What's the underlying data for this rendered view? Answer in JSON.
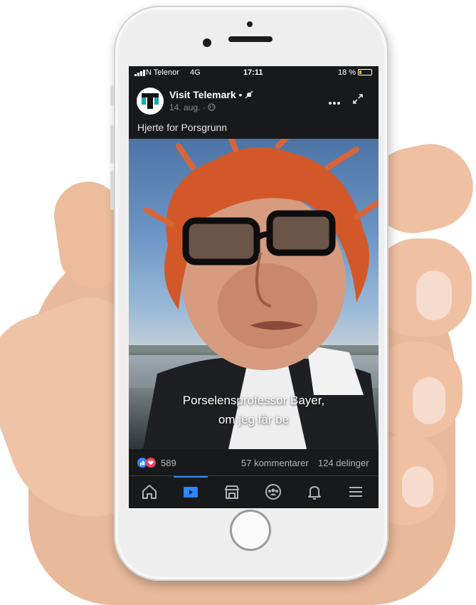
{
  "status_bar": {
    "carrier": "N Telenor",
    "network": "4G",
    "time": "17:11",
    "battery": "18 %",
    "battery_level": 0.18
  },
  "post": {
    "page_name": "Visit Telemark",
    "separator": "•",
    "date": "14. aug.",
    "caption": "Hjerte for Porsgrunn",
    "avatar_text": "T"
  },
  "video": {
    "subtitle_line1": "Porselensprofessor Bayer,",
    "subtitle_line2": "om jeg får be"
  },
  "reactions": {
    "count": "589",
    "comments": "57 kommentarer",
    "shares": "124 delinger",
    "like_color": "#2d88ff",
    "love_color": "#f33e58"
  },
  "tabs": [
    {
      "name": "home-icon"
    },
    {
      "name": "watch-icon",
      "active": true
    },
    {
      "name": "marketplace-icon"
    },
    {
      "name": "groups-icon"
    },
    {
      "name": "notifications-icon"
    },
    {
      "name": "menu-icon"
    }
  ],
  "colors": {
    "screen_bg": "#18191a",
    "accent": "#2d88ff",
    "hair": "#d2582a"
  }
}
